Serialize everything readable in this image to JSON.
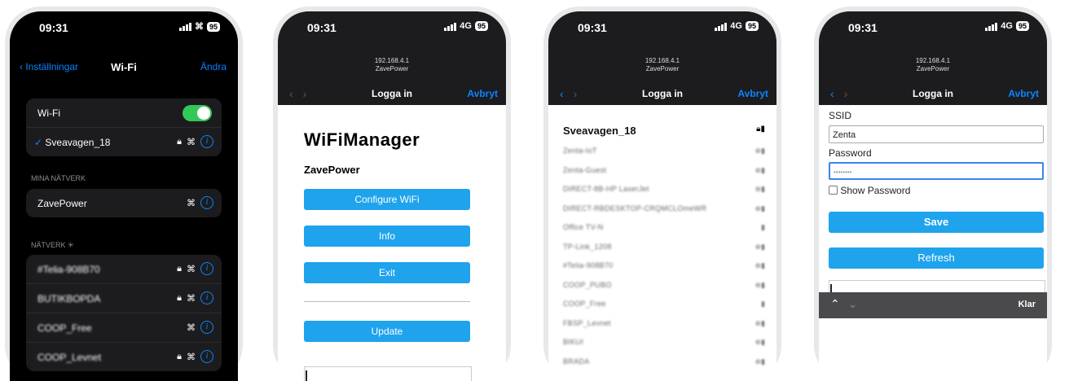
{
  "phone1": {
    "status": {
      "time": "09:31",
      "battery": "95"
    },
    "nav": {
      "back": "Inställningar",
      "title": "Wi-Fi",
      "edit": "Ändra"
    },
    "wifi_toggle_label": "Wi-Fi",
    "connected": "Sveavagen_18",
    "my_networks_header": "MINA NÄTVERK",
    "my_networks": [
      "ZavePower"
    ],
    "networks_header": "NÄTVERK",
    "networks": [
      {
        "name": "#Telia-908B70",
        "lock": true
      },
      {
        "name": "BUTIKBOPDA",
        "lock": true
      },
      {
        "name": "COOP_Free",
        "lock": false
      },
      {
        "name": "COOP_Levnet",
        "lock": true
      }
    ]
  },
  "phone2": {
    "status": {
      "time": "09:31",
      "network": "4G",
      "battery": "95"
    },
    "url_ip": "192.168.4.1",
    "url_host": "ZavePower",
    "nav_title": "Logga in",
    "nav_cancel": "Avbryt",
    "heading": "WiFiManager",
    "device": "ZavePower",
    "buttons": [
      "Configure WiFi",
      "Info",
      "Exit",
      "Update"
    ]
  },
  "phone3": {
    "status": {
      "time": "09:31",
      "network": "4G",
      "battery": "95"
    },
    "url_ip": "192.168.4.1",
    "url_host": "ZavePower",
    "nav_title": "Logga in",
    "nav_cancel": "Avbryt",
    "first_network": "Sveavagen_18",
    "networks": [
      "Zenta-IoT",
      "Zenta-Guest",
      "DIRECT-8B-HP LaserJet",
      "DIRECT-RBDESKTOP-CRQMCLOmeWR",
      "Office TV-N",
      "TP-Link_1208",
      "#Telia-908B70",
      "COOP_PUBO",
      "COOP_Free",
      "FBSP_Levnet",
      "BIKUI",
      "BRADA"
    ]
  },
  "phone4": {
    "status": {
      "time": "09:31",
      "network": "4G",
      "battery": "95"
    },
    "url_ip": "192.168.4.1",
    "url_host": "ZavePower",
    "nav_title": "Logga in",
    "nav_cancel": "Avbryt",
    "ssid_label": "SSID",
    "ssid_value": "Zenta",
    "password_label": "Password",
    "password_value": "••••••••",
    "show_password": "Show Password",
    "save": "Save",
    "refresh": "Refresh",
    "keyboard_done": "Klar"
  }
}
